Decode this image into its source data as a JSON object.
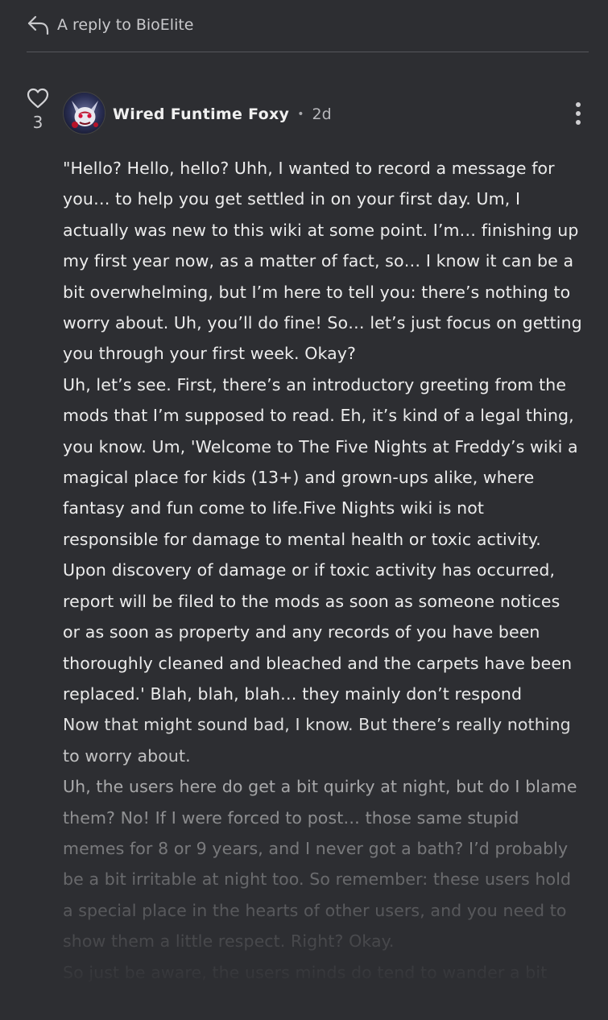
{
  "reply_header": {
    "text": "A reply to BioElite",
    "icon": "reply-arrow-icon"
  },
  "post": {
    "likes": "3",
    "author": "Wired Funtime Foxy",
    "separator": "•",
    "time": "2d",
    "lines": [
      "\"Hello? Hello, hello? Uhh, I wanted to record a message for",
      "you… to help you get settled in on your first day. Um, I",
      "actually was new to this wiki at some point. I’m… finishing up",
      "my first year now, as a matter of fact, so… I know it can be a",
      "bit overwhelming, but I’m here to tell you: there’s nothing to",
      "worry about. Uh, you’ll do fine! So… let’s just focus on getting",
      "you through your first week. Okay?",
      "Uh, let’s see. First, there’s an introductory greeting from the",
      "mods that I’m supposed to read. Eh, it’s kind of a legal thing,",
      "you know. Um, 'Welcome to The Five Nights at Freddy’s wiki a",
      "magical place for kids (13+) and grown-ups alike, where",
      "fantasy and fun come to life.Five Nights wiki is not",
      "responsible for damage to mental health or toxic activity.",
      "Upon discovery of damage or if toxic activity has occurred,",
      "report will be filed to the mods as soon as someone notices",
      "or as soon as property and any records of you have been",
      "thoroughly cleaned and bleached and the carpets have been",
      "replaced.' Blah, blah, blah… they mainly don’t respond",
      "Now that might sound bad, I know. But there’s really nothing",
      "to worry about.",
      "Uh, the users here do get a bit quirky at night, but do I blame",
      "them? No! If I were forced to post… those same stupid",
      "memes for 8 or 9 years, and I never got a bath? I’d probably",
      "be a bit irritable at night too. So remember: these users hold",
      "a special place in the hearts of other users, and you need to",
      "show them a little respect. Right? Okay.",
      "So just be aware, the users minds do tend to wander a bit"
    ]
  },
  "colors": {
    "background": "#2d2e32",
    "text": "#ececec",
    "muted": "#c9c9cc"
  }
}
